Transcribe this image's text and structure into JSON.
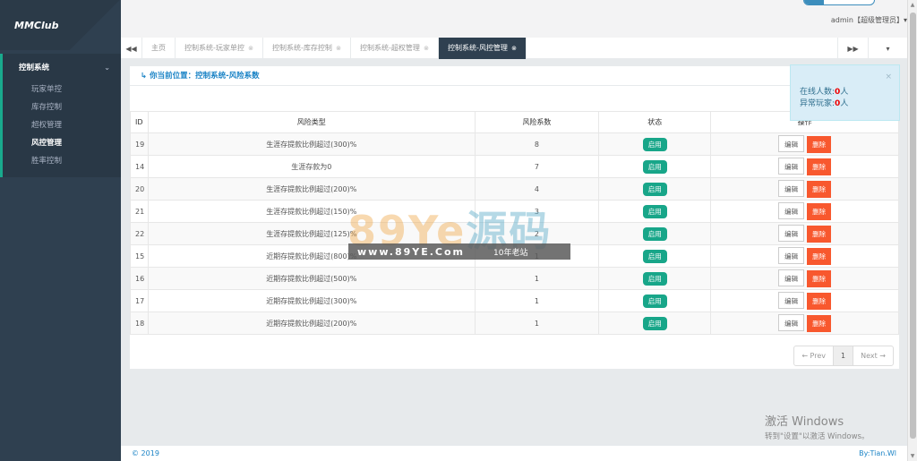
{
  "app": {
    "logo": "MMClub"
  },
  "sidebar": {
    "group_label": "控制系统",
    "items": [
      {
        "label": "玩家单控",
        "active": false
      },
      {
        "label": "库存控制",
        "active": false
      },
      {
        "label": "超权管理",
        "active": false
      },
      {
        "label": "风控管理",
        "active": true
      },
      {
        "label": "胜率控制",
        "active": false
      }
    ]
  },
  "header": {
    "user": "admin【超级管理员】▾"
  },
  "tabs": {
    "prev_icon": "double-left-icon",
    "next_icon": "double-right-icon",
    "items": [
      {
        "label": "主页",
        "closable": false,
        "active": false
      },
      {
        "label": "控制系统-玩家单控",
        "closable": true,
        "active": false
      },
      {
        "label": "控制系统-库存控制",
        "closable": true,
        "active": false
      },
      {
        "label": "控制系统-超权管理",
        "closable": true,
        "active": false
      },
      {
        "label": "控制系统-风控管理",
        "closable": true,
        "active": true
      }
    ]
  },
  "breadcrumb": "你当前位置：控制系统-风险系数",
  "table": {
    "headers": [
      "ID",
      "风险类型",
      "风险系数",
      "状态",
      "操作"
    ],
    "rows": [
      {
        "id": "19",
        "type": "生涯存提款比例超过(300)%",
        "coef": "8",
        "status": "启用"
      },
      {
        "id": "14",
        "type": "生涯存款为0",
        "coef": "7",
        "status": "启用"
      },
      {
        "id": "20",
        "type": "生涯存提款比例超过(200)%",
        "coef": "4",
        "status": "启用"
      },
      {
        "id": "21",
        "type": "生涯存提款比例超过(150)%",
        "coef": "3",
        "status": "启用"
      },
      {
        "id": "22",
        "type": "生涯存提款比例超过(125)%",
        "coef": "2",
        "status": "启用"
      },
      {
        "id": "15",
        "type": "近期存提款比例超过(800)%",
        "coef": "1",
        "status": "启用"
      },
      {
        "id": "16",
        "type": "近期存提款比例超过(500)%",
        "coef": "1",
        "status": "启用"
      },
      {
        "id": "17",
        "type": "近期存提款比例超过(300)%",
        "coef": "1",
        "status": "启用"
      },
      {
        "id": "18",
        "type": "近期存提款比例超过(200)%",
        "coef": "1",
        "status": "启用"
      }
    ],
    "edit_label": "编辑",
    "delete_label": "删除"
  },
  "pager": {
    "prev": "← Prev",
    "current": "1",
    "next": "Next →"
  },
  "toast": {
    "online_label": "在线人数:",
    "online_count": "0",
    "online_unit": "人",
    "abnormal_label": "异常玩家:",
    "abnormal_count": "0",
    "abnormal_unit": "人",
    "close": "×"
  },
  "watermark": {
    "logo_latin": "89Ye",
    "logo_zh": "源码",
    "url": "www.89YE.Com",
    "slogan": "10年老站"
  },
  "os_notice": {
    "title": "激活 Windows",
    "subtitle": "转到\"设置\"以激活 Windows。"
  },
  "footer": {
    "copyright": "© 2019",
    "author": "By:Tian.Wl"
  },
  "colors": {
    "sidebar": "#2f4050",
    "accent": "#18a689",
    "danger": "#f8582e",
    "link": "#1c84c6"
  }
}
